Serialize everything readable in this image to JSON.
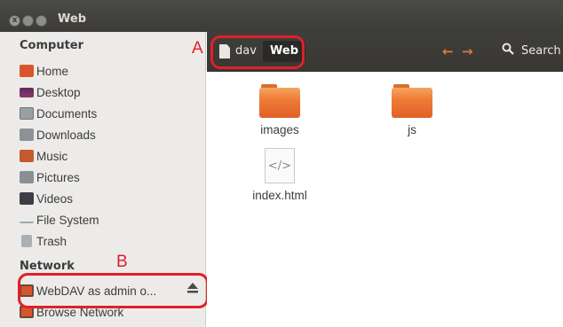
{
  "window": {
    "title": "Web",
    "close_glyph": "x"
  },
  "toolbar": {
    "crumbs": [
      "dav",
      "Web"
    ],
    "back_icon": "←",
    "forward_icon": "→",
    "search_label": "Search"
  },
  "annotations": {
    "a": "A",
    "b": "B"
  },
  "sidebar": {
    "computer_header": "Computer",
    "items": [
      "Home",
      "Desktop",
      "Documents",
      "Downloads",
      "Music",
      "Pictures",
      "Videos",
      "File System",
      "Trash"
    ],
    "network_header": "Network",
    "network_items": [
      "WebDAV as admin o...",
      "Browse Network"
    ]
  },
  "files": [
    {
      "name": "images",
      "icon": "folder-icon"
    },
    {
      "name": "js",
      "icon": "folder-icon"
    },
    {
      "name": "index.html",
      "icon": "html-file-icon",
      "glyph": "</>"
    }
  ],
  "colors": {
    "accent": "#E95420",
    "annotation": "#E0202A",
    "toolbar": "#3C3B37"
  }
}
